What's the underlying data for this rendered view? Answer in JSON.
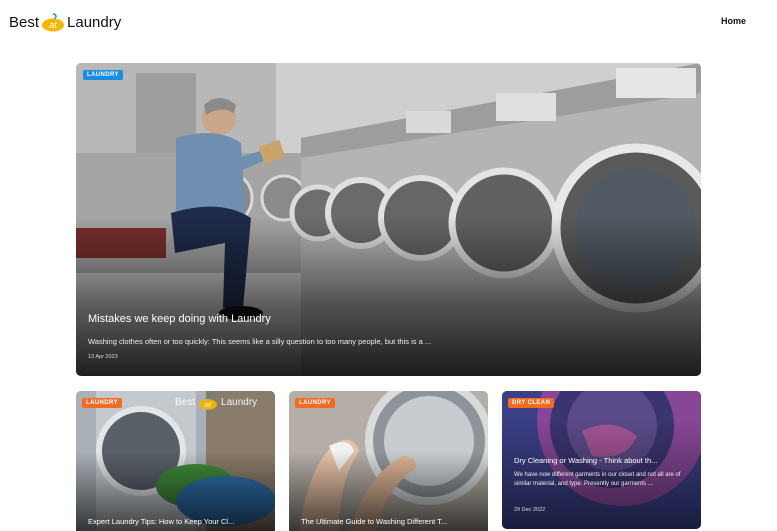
{
  "header": {
    "logo_left": "Best",
    "logo_mark": "at",
    "logo_right": "Laundry",
    "nav": {
      "home": "Home"
    }
  },
  "featured": {
    "category": "Laundry",
    "title": "Mistakes we keep doing with Laundry",
    "excerpt": "Washing clothes often or too quickly: This seems like a silly question to too many people, but this is a ...",
    "date": "13 Apr 2023"
  },
  "cards": [
    {
      "category": "Laundry",
      "title": "Expert Laundry Tips: How to Keep Your Cl...",
      "watermark_left": "Best",
      "watermark_right": "Laundry"
    },
    {
      "category": "Laundry",
      "title": "The Ultimate Guide to Washing Different T..."
    },
    {
      "category": "Dry Clean",
      "title": "Dry Cleaning or Washing - Think about th...",
      "excerpt": "We have now different garments in our closet and not all are of similar material, and type. Presently our garments ...",
      "date": "29 Dec 2022"
    }
  ],
  "colors": {
    "badge_blue": "#1b8de0",
    "badge_orange": "#f26b21",
    "logo_accent": "#f5b800",
    "logo_blue": "#1b8de0"
  },
  "icons": {
    "logo": "hanger-logo-icon"
  }
}
